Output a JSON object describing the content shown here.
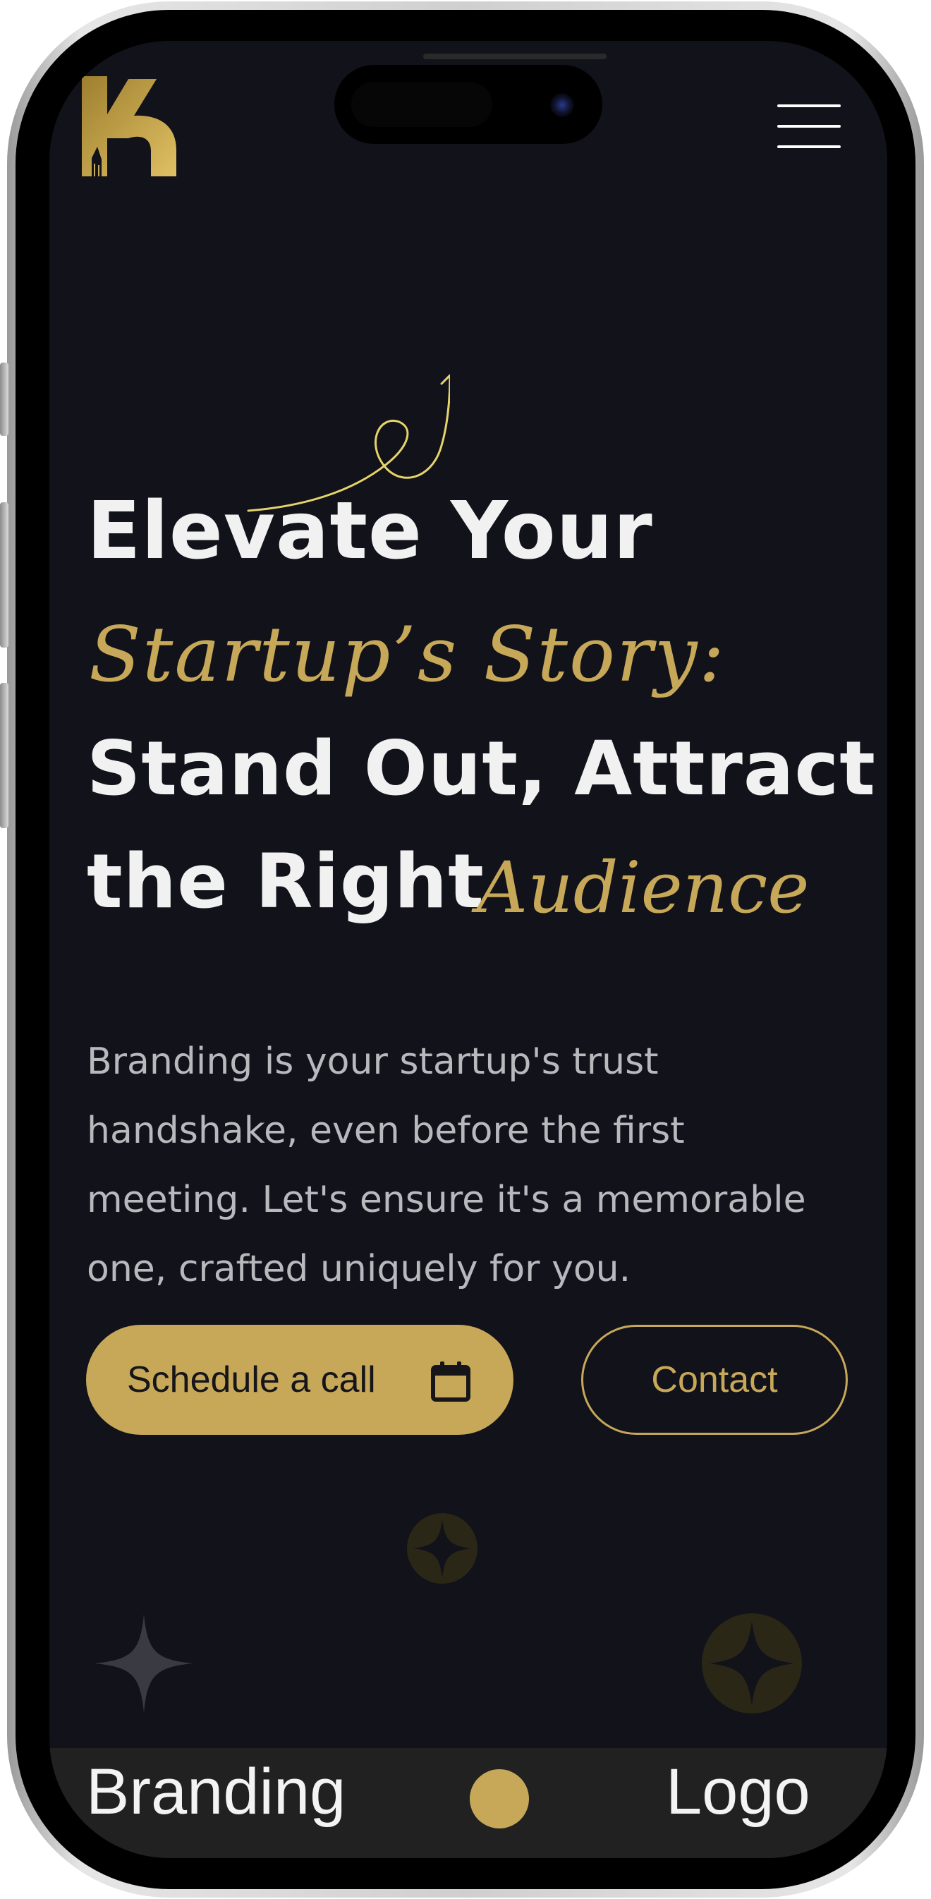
{
  "header": {
    "logo_icon": "k-logo-icon",
    "menu_icon": "hamburger-icon"
  },
  "hero": {
    "line1": "Elevate Your",
    "script1": "Startup’s Story:",
    "line2": "Stand Out, Attract",
    "line3": "the Right",
    "script2": "Audience",
    "decoration_icon": "swirl-arrow-icon",
    "description": "Branding is your startup's trust handshake, even before the first meeting. Let's ensure it's a memorable one, crafted uniquely for you."
  },
  "actions": {
    "schedule_label": "Schedule a call",
    "schedule_icon": "calendar-icon",
    "contact_label": "Contact"
  },
  "strip": {
    "item1": "Branding",
    "item2": "Logo"
  },
  "colors": {
    "background": "#11121a",
    "accent_gold": "#c7a859",
    "heading": "#f1f1f1",
    "body_text": "#b8b8bd",
    "strip_bg": "#212121"
  }
}
